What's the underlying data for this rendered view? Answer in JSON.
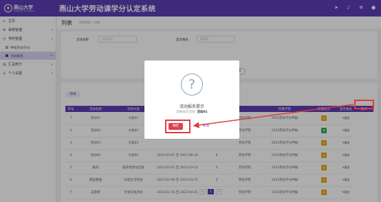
{
  "header": {
    "logo_text": "燕山大学",
    "logo_sub": "YANSHAN UNIVERSITY",
    "app_title": "燕山大学劳动课学分认定系统",
    "icons": [
      "send-icon",
      "bell-icon",
      "gear-icon",
      "user-icon"
    ]
  },
  "sidebar": {
    "items": [
      {
        "label": "主页",
        "icon": "home-icon"
      },
      {
        "label": "系统管理",
        "icon": "settings-icon"
      },
      {
        "label": "学时管理",
        "icon": "clock-icon"
      },
      {
        "label": "汇总统计",
        "icon": "chart-icon"
      },
      {
        "label": "个人设置",
        "icon": "user-icon"
      }
    ],
    "subitems": [
      {
        "label": "申报劳动学分"
      },
      {
        "label": "活动报名"
      }
    ]
  },
  "page": {
    "title": "列表",
    "breadcrumb": "劳动申报 > 列表"
  },
  "search": {
    "name_label": "活动名称",
    "name_placeholder": "活动名称",
    "status_label": "是否报名",
    "status_placeholder": "请选择",
    "search_button": "查询",
    "reset_button": "重置"
  },
  "table": {
    "new_button": "新增",
    "headers": [
      "序号",
      "活动名称",
      "活动大类",
      "活动时间",
      "",
      "",
      "所属学院",
      "所属批次",
      "是否报名",
      "操作"
    ],
    "rows": [
      {
        "no": "1",
        "name": "活动01",
        "cat": "大类01",
        "time": "",
        "c5": "",
        "college": "劳动学院",
        "batch": "2023劳动学分申报",
        "signed": "否",
        "signed_color": "yellow",
        "op": "报名"
      },
      {
        "no": "2",
        "name": "活动02",
        "cat": "大类02",
        "time": "",
        "c5": "",
        "college": "劳动学院",
        "batch": "2023劳动学分申报",
        "signed": "是",
        "signed_color": "green",
        "op": "报名"
      },
      {
        "no": "3",
        "name": "活动03",
        "cat": "大类03",
        "time": "",
        "c5": "",
        "college": "劳动学院",
        "batch": "2023劳动学分申报",
        "signed": "否",
        "signed_color": "yellow",
        "op": "报名"
      },
      {
        "no": "4",
        "name": "活动02",
        "cat": "大类02",
        "time": "2023-03-01 至 2023-06-30",
        "c5": "8",
        "college": "劳动学院",
        "batch": "2023劳动学分申报",
        "signed": "否",
        "signed_color": "yellow",
        "op": "报名"
      },
      {
        "no": "5",
        "name": "服务",
        "cat": "服务性劳动实践",
        "time": "2023-03-01 至 2023-03-12",
        "c5": "3",
        "college": "劳动学院",
        "batch": "2023劳动学分申报",
        "signed": "否",
        "signed_color": "yellow",
        "op": "报名"
      },
      {
        "no": "6",
        "name": "教室整理",
        "cat": "日常生活劳动",
        "time": "2023-03-09 至 2023-03-25",
        "c5": "2",
        "college": "劳动学院",
        "batch": "2023劳动学分申报",
        "signed": "否",
        "signed_color": "yellow",
        "op": "报名"
      },
      {
        "no": "7",
        "name": "志愿者",
        "cat": "社会实践活动",
        "time": "2023-03-16 至 2023-04-01",
        "c5": "1",
        "college": "劳动学院",
        "batch": "2023劳动学分申报",
        "signed": "否",
        "signed_color": "yellow",
        "op": "报名"
      }
    ]
  },
  "pager": {
    "pages": [
      "<",
      "1",
      ">"
    ],
    "current": "1"
  },
  "dialog": {
    "title": "活动报名提示",
    "message_prefix": "您报名的活动:",
    "message_value": "活动01",
    "ok_button": "确定",
    "cancel_button": "取消"
  },
  "colors": {
    "brand": "#5b3fb6",
    "danger": "#e0404f",
    "highlight": "#e23b3b"
  }
}
